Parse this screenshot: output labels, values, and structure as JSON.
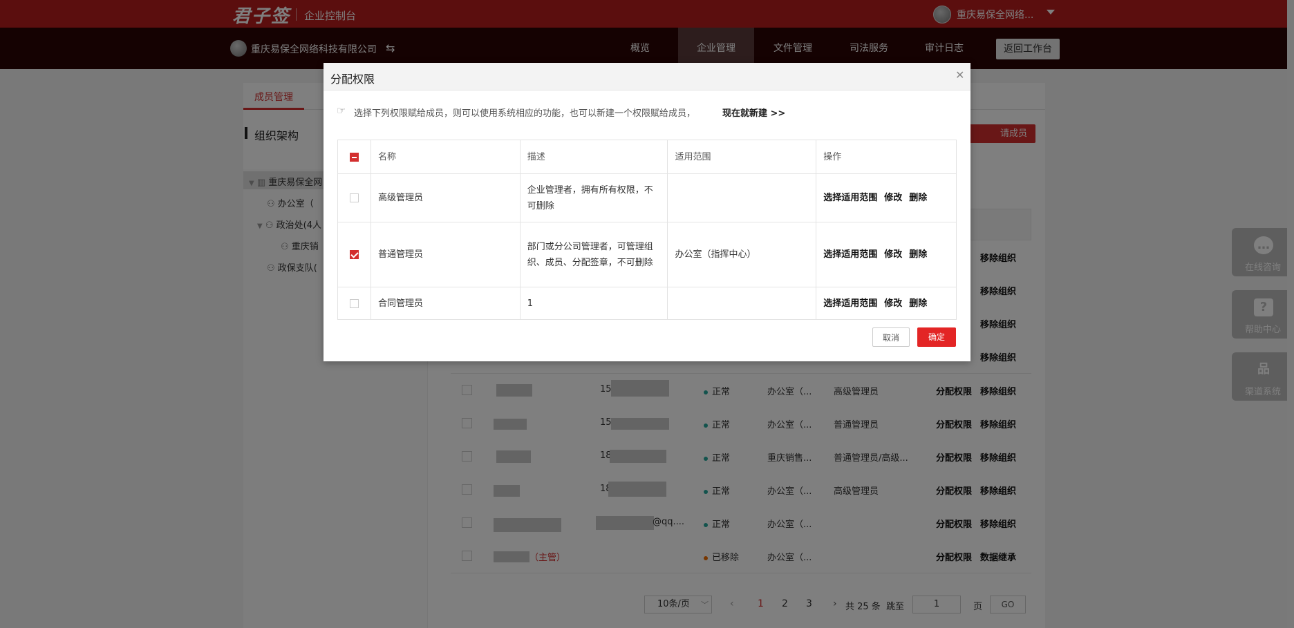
{
  "topbar": {
    "logo": "君子签",
    "console": "企业控制台",
    "account_name": "重庆易保全网络...",
    "accent": "#b71c1c"
  },
  "navbar": {
    "company": "重庆易保全网络科技有限公司",
    "items": [
      "概览",
      "企业管理",
      "文件管理",
      "司法服务",
      "审计日志"
    ],
    "active": "企业管理",
    "back_label": "返回工作台"
  },
  "page": {
    "tab": "成员管理",
    "org_title": "组织架构",
    "invite_label": "请成员",
    "tree": [
      {
        "label": "重庆易保全网"
      },
      {
        "label": "办公室（"
      },
      {
        "label": "政治处(4人"
      },
      {
        "label": "重庆销"
      },
      {
        "label": "政保支队("
      }
    ],
    "rows": [
      {
        "phone_prefix": "15",
        "status": "正常",
        "dept": "办公室（...",
        "role": "高级管理员",
        "op1": "分配权限",
        "op2": "移除组织"
      },
      {
        "phone_prefix": "15",
        "status": "正常",
        "dept": "办公室（...",
        "role": "普通管理员",
        "op1": "分配权限",
        "op2": "移除组织"
      },
      {
        "phone_prefix": "18",
        "status": "正常",
        "dept": "重庆销售...",
        "role": "普通管理员/高级...",
        "op1": "分配权限",
        "op2": "移除组织"
      },
      {
        "phone_prefix": "18",
        "status": "正常",
        "dept": "办公室（...",
        "role": "高级管理员",
        "op1": "分配权限",
        "op2": "移除组织"
      },
      {
        "phone_prefix": "@qq....",
        "status": "正常",
        "dept": "办公室（...",
        "role": "",
        "op1": "分配权限",
        "op2": "移除组织"
      },
      {
        "phone_prefix": "",
        "status": "已移除",
        "dept": "办公室（...",
        "role": "",
        "op1": "分配权限",
        "op2": "数据继承",
        "tag": "（主管）"
      }
    ],
    "hidden_ops": [
      "移除组织",
      "移除组织",
      "移除组织",
      "移除组织"
    ],
    "pagination": {
      "page_size": "10条/页",
      "pages": [
        "1",
        "2",
        "3"
      ],
      "current": "1",
      "total": "共 25 条",
      "jump_label": "跳至",
      "jump_value": "1",
      "page_unit": "页",
      "go": "GO"
    }
  },
  "floats": [
    {
      "label": "在线咨询",
      "icon": "chat-icon"
    },
    {
      "label": "帮助中心",
      "icon": "help-icon"
    },
    {
      "label": "渠道系统",
      "icon": "org-chart-icon"
    }
  ],
  "modal": {
    "title": "分配权限",
    "hint": "选择下列权限赋给成员，则可以使用系统相应的功能，也可以新建一个权限赋给成员，",
    "hint_link": "现在就新建 >>",
    "columns": [
      "名称",
      "描述",
      "适用范围",
      "操作"
    ],
    "rows": [
      {
        "checked": false,
        "name": "高级管理员",
        "desc": "企业管理者，拥有所有权限，不可删除",
        "scope": "",
        "ops": [
          "选择适用范围",
          "修改",
          "删除"
        ]
      },
      {
        "checked": true,
        "name": "普通管理员",
        "desc": "部门或分公司管理者，可管理组织、成员、分配签章，不可删除",
        "scope": "办公室（指挥中心）",
        "ops": [
          "选择适用范围",
          "修改",
          "删除"
        ]
      },
      {
        "checked": false,
        "name": "合同管理员",
        "desc": "1",
        "scope": "",
        "ops": [
          "选择适用范围",
          "修改",
          "删除"
        ]
      }
    ],
    "cancel": "取消",
    "ok": "确定"
  }
}
